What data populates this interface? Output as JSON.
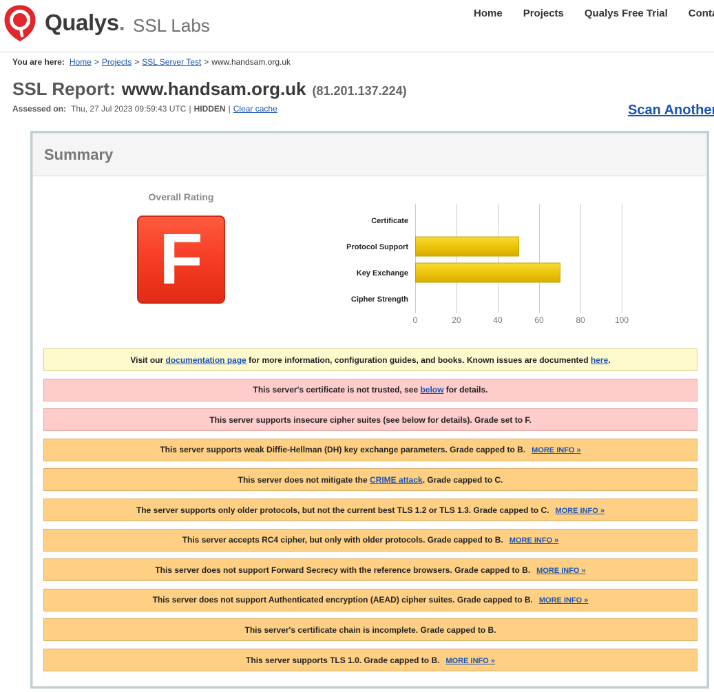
{
  "theme": {
    "brand_red": "#e3262b",
    "link": "#1a54b4",
    "panel_border": "#bfd0d6",
    "notice_info": "#fffacd",
    "notice_error": "#ffcccc",
    "notice_warning": "#ffd083"
  },
  "header": {
    "logo": {
      "icon": "qualys-shield-icon",
      "brand": "Qualys",
      "dot": ".",
      "product": "SSL Labs"
    },
    "nav": [
      {
        "label": "Home"
      },
      {
        "label": "Projects"
      },
      {
        "label": "Qualys Free Trial"
      },
      {
        "label": "Conta"
      }
    ]
  },
  "breadcrumb": {
    "label": "You are here:",
    "links": [
      "Home",
      "Projects",
      "SSL Server Test"
    ],
    "separator": ">",
    "current": "www.handsam.org.uk"
  },
  "report": {
    "title_prefix": "SSL Report:",
    "hostname": "www.handsam.org.uk",
    "ip": "(81.201.137.224)",
    "assessed_label": "Assessed on:",
    "assessed_value": "Thu, 27 Jul 2023 09:59:43 UTC",
    "separator": "|",
    "visibility": "HIDDEN",
    "clear_cache": "Clear cache",
    "scan_another": "Scan Another"
  },
  "summary": {
    "title": "Summary",
    "overall_rating_label": "Overall Rating",
    "grade": "F",
    "grade_color": "#f43a22"
  },
  "chart_data": {
    "type": "bar",
    "orientation": "horizontal",
    "categories": [
      "Certificate",
      "Protocol Support",
      "Key Exchange",
      "Cipher Strength"
    ],
    "values": [
      0,
      50,
      70,
      0
    ],
    "xlim": [
      0,
      100
    ],
    "xticks": [
      0,
      20,
      40,
      60,
      80,
      100
    ],
    "grid": true,
    "legend": "none",
    "bar_color": "#efc70c"
  },
  "notices": [
    {
      "type": "info",
      "parts": [
        {
          "text": "Visit our "
        },
        {
          "link": "documentation page"
        },
        {
          "text": " for more information, configuration guides, and books. Known issues are documented "
        },
        {
          "link": "here"
        },
        {
          "text": "."
        }
      ]
    },
    {
      "type": "error",
      "parts": [
        {
          "text": "This server's certificate is not trusted, see "
        },
        {
          "link": "below"
        },
        {
          "text": " for details."
        }
      ]
    },
    {
      "type": "error",
      "parts": [
        {
          "text": "This server supports insecure cipher suites (see below for details). Grade set to F."
        }
      ]
    },
    {
      "type": "warning",
      "parts": [
        {
          "text": "This server supports weak Diffie-Hellman (DH) key exchange parameters. Grade capped to B."
        }
      ],
      "more_info": "MORE INFO »"
    },
    {
      "type": "warning",
      "parts": [
        {
          "text": "This server does not mitigate the "
        },
        {
          "link": "CRIME attack"
        },
        {
          "text": ". Grade capped to C."
        }
      ]
    },
    {
      "type": "warning",
      "parts": [
        {
          "text": "The server supports only older protocols, but not the current best TLS 1.2 or TLS 1.3. Grade capped to C."
        }
      ],
      "more_info": "MORE INFO »"
    },
    {
      "type": "warning",
      "parts": [
        {
          "text": "This server accepts RC4 cipher, but only with older protocols. Grade capped to B."
        }
      ],
      "more_info": "MORE INFO »"
    },
    {
      "type": "warning",
      "parts": [
        {
          "text": "This server does not support Forward Secrecy with the reference browsers. Grade capped to B."
        }
      ],
      "more_info": "MORE INFO »"
    },
    {
      "type": "warning",
      "parts": [
        {
          "text": "This server does not support Authenticated encryption (AEAD) cipher suites. Grade capped to B."
        }
      ],
      "more_info": "MORE INFO »"
    },
    {
      "type": "warning",
      "parts": [
        {
          "text": "This server's certificate chain is incomplete. Grade capped to B."
        }
      ]
    },
    {
      "type": "warning",
      "parts": [
        {
          "text": "This server supports TLS 1.0. Grade capped to B."
        }
      ],
      "more_info": "MORE INFO »"
    }
  ]
}
